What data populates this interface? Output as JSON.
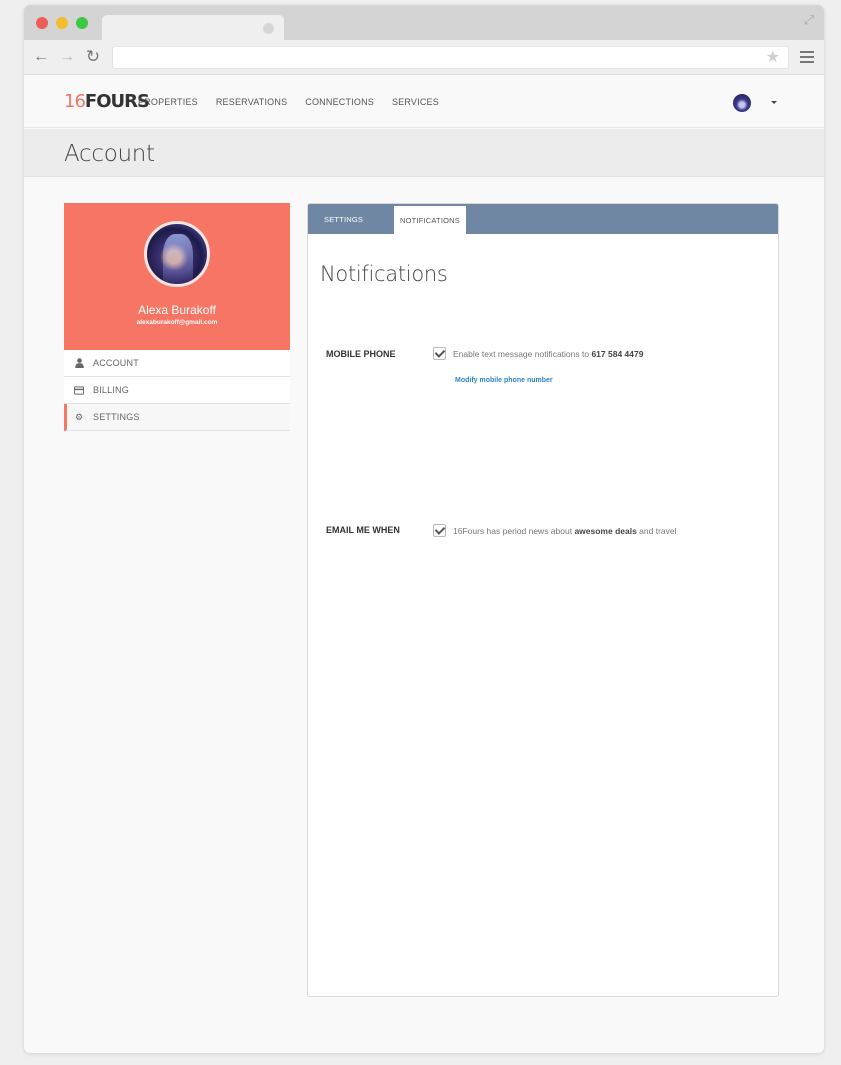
{
  "browser": {
    "url": ""
  },
  "site": {
    "logo_number": "16",
    "logo_word": "FOURS",
    "nav": [
      "PROPERTIES",
      "RESERVATIONS",
      "CONNECTIONS",
      "SERVICES"
    ]
  },
  "page": {
    "title": "Account"
  },
  "profile": {
    "name": "Alexa Burakoff",
    "email": "alexaburakoff@gmail.com"
  },
  "side_menu": [
    {
      "label": "ACCOUNT",
      "icon": "user-icon"
    },
    {
      "label": "BILLING",
      "icon": "credit-card-icon"
    },
    {
      "label": "SETTINGS",
      "icon": "gear-icon",
      "active": true
    }
  ],
  "panel": {
    "tabs": [
      "SETTINGS",
      "NOTIFICATIONS"
    ],
    "active_tab": "NOTIFICATIONS",
    "heading": "Notifications",
    "mobile": {
      "label": "MOBILE PHONE",
      "checked": true,
      "text_prefix": "Enable text message notifications to ",
      "phone": "617 584 4479",
      "link": "Modify mobile phone number"
    },
    "email": {
      "label": "EMAIL ME WHEN",
      "checked": true,
      "text_prefix": "16Fours has period news about ",
      "text_bold": "awesome deals",
      "text_suffix": " and travel"
    }
  },
  "colors": {
    "accent": "#f77565",
    "tab_bar": "#6f87a3",
    "link": "#2c86c9"
  }
}
